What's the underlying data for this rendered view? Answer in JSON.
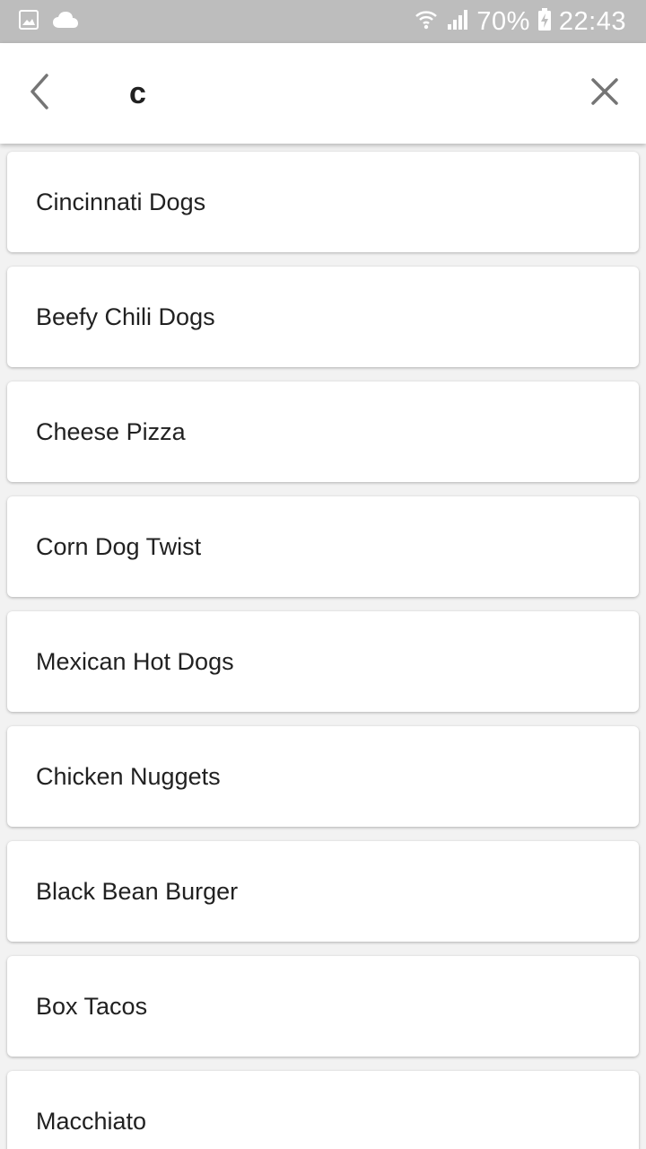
{
  "status_bar": {
    "battery": "70%",
    "time": "22:43",
    "left_icons": [
      "image-icon",
      "cloud-icon"
    ],
    "right_icons": [
      "wifi-icon",
      "signal-icon",
      "battery-charging-icon"
    ]
  },
  "search": {
    "query": "c",
    "back_icon": "chevron-left-icon",
    "clear_icon": "close-icon"
  },
  "results": [
    "Cincinnati Dogs",
    "Beefy Chili Dogs",
    "Cheese Pizza",
    "Corn Dog Twist",
    "Mexican Hot Dogs",
    "Chicken Nuggets",
    "Black Bean Burger",
    "Box Tacos",
    "Macchiato"
  ],
  "colors": {
    "status_bar_bg": "#bdbdbd",
    "app_bar_bg": "#ffffff",
    "page_bg": "#f2f2f2",
    "icon_gray": "#757575",
    "text_dark": "#212121"
  }
}
